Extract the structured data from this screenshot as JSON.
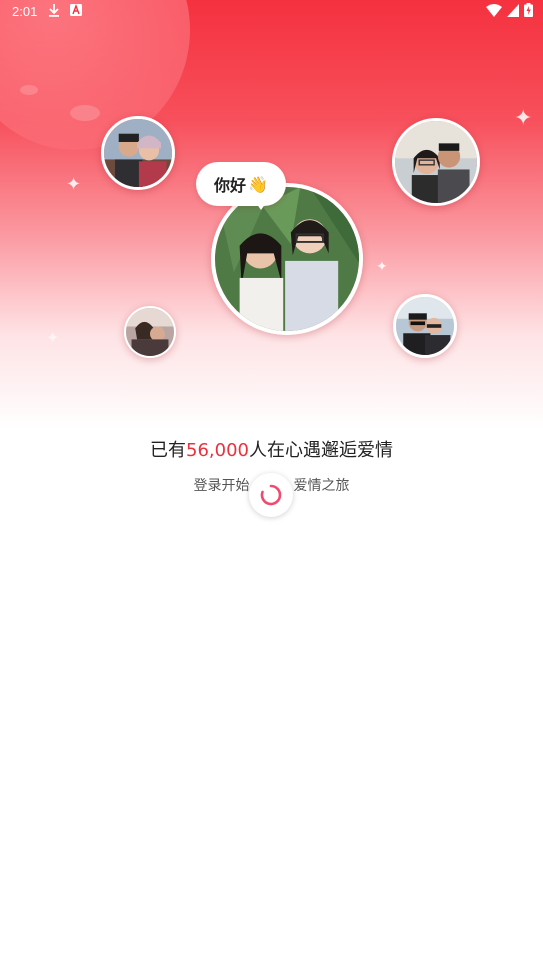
{
  "status_bar": {
    "time": "2:01",
    "left_icons": [
      "download-icon",
      "a-box-icon"
    ],
    "right_icons": [
      "wifi-icon",
      "signal-icon",
      "battery-charging-icon"
    ]
  },
  "bubble": {
    "text": "你好",
    "emoji": "👋"
  },
  "headline": {
    "prefix": "已有",
    "count": "56,000",
    "suffix": "人在心遇邂逅爱情"
  },
  "subline": {
    "text_left": "登录开始",
    "text_right": "爱情之旅"
  },
  "colors": {
    "accent": "#e8333f",
    "hero_top": "#f5313f",
    "spinner": "#f04b6e"
  }
}
